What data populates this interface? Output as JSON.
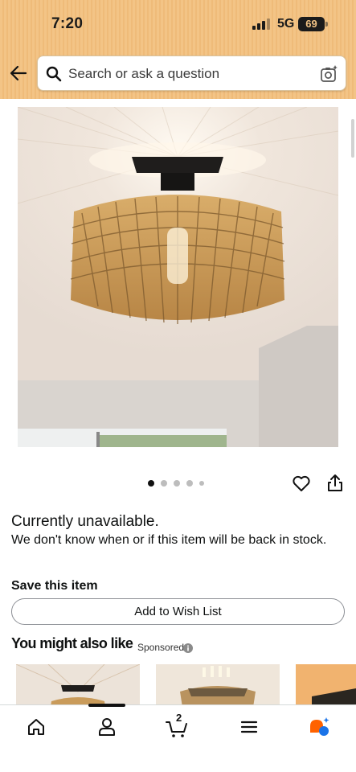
{
  "status_bar": {
    "time": "7:20",
    "network": "5G",
    "battery": "69"
  },
  "search": {
    "placeholder": "Search or ask a question"
  },
  "carousel": {
    "total_images": 5,
    "active_index": 0
  },
  "availability": {
    "title": "Currently unavailable.",
    "message": "We don't know when or if this item will be back in stock."
  },
  "save": {
    "title": "Save this item",
    "wishlist_button": "Add to Wish List"
  },
  "recommendations": {
    "title": "You might also like",
    "sponsored_label": "Sponsored"
  },
  "bottom_nav": {
    "items": [
      "home-icon",
      "account-icon",
      "cart-icon",
      "menu-icon",
      "rufus-icon"
    ],
    "cart_count": "2"
  },
  "icons": [
    "back-arrow-icon",
    "search-icon",
    "camera-search-icon",
    "heart-icon",
    "share-icon",
    "info-icon"
  ],
  "colors": {
    "header_bg": "#f3c486",
    "text": "#0f1111",
    "rufus_orange": "#ff6200",
    "rufus_blue": "#1a73e8"
  }
}
